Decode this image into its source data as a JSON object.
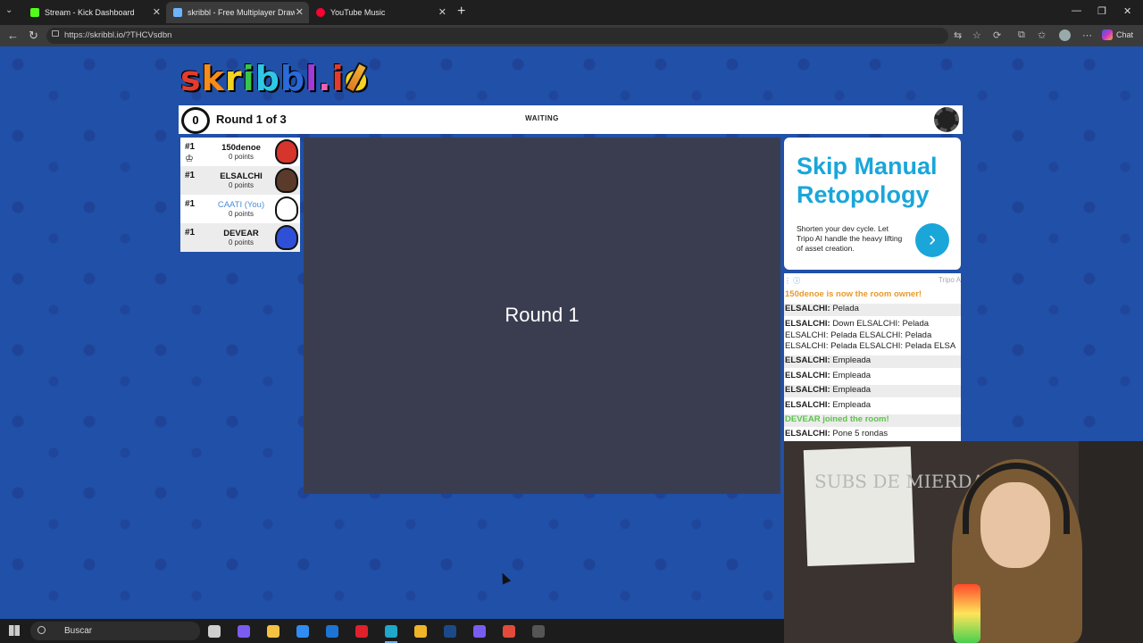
{
  "browser": {
    "tabs": [
      {
        "label": "Stream - Kick Dashboard",
        "icon": "kick-icon",
        "color": "#53fc18"
      },
      {
        "label": "skribbl - Free Multiplayer Drawing",
        "icon": "skribbl-icon",
        "color": "#6fb4ff"
      },
      {
        "label": "YouTube Music",
        "icon": "youtube-music-icon",
        "color": "#ff0033"
      }
    ],
    "url": "https://skribbl.io/?THCVsdbn",
    "chat_label": "Chat"
  },
  "game": {
    "logo_letters": [
      "s",
      "k",
      "r",
      "i",
      "b",
      "b",
      "l",
      ".",
      "i",
      "o"
    ],
    "logo_colors": [
      "#e53b2e",
      "#f58c1c",
      "#f4d21f",
      "#38c646",
      "#2fc7e6",
      "#2a6ad9",
      "#a23bd6",
      "#f05fb0",
      "#e53b2e",
      "#f4d21f"
    ],
    "timer": "0",
    "round_label": "Round 1 of 3",
    "status": "WAITING",
    "canvas_text": "Round 1",
    "players": [
      {
        "rank": "#1",
        "name": "150denoe",
        "points": "0 points",
        "avatar_color": "#d6352b",
        "owner": true,
        "you": false
      },
      {
        "rank": "#1",
        "name": "ELSALCHI",
        "points": "0 points",
        "avatar_color": "#5a3a2a",
        "owner": false,
        "you": false
      },
      {
        "rank": "#1",
        "name": "CAATI (You)",
        "points": "0 points",
        "avatar_color": "#ffffff",
        "owner": false,
        "you": true
      },
      {
        "rank": "#1",
        "name": "DEVEAR",
        "points": "0 points",
        "avatar_color": "#2f4fd6",
        "owner": false,
        "you": false
      }
    ]
  },
  "ad": {
    "title": "Skip Manual Retopology",
    "body": "Shorten your dev cycle. Let Tripo AI handle the heavy lifting of asset creation.",
    "sponsor": "Tripo A",
    "arrow": "›"
  },
  "chat": {
    "messages": [
      {
        "type": "system-orange",
        "text": "150denoe is now the room owner!"
      },
      {
        "type": "msg",
        "author": "ELSALCHI:",
        "text": "Pelada"
      },
      {
        "type": "msg",
        "author": "ELSALCHI:",
        "text": "Down ELSALCHI: Pelada ELSALCHI: Pelada ELSALCHI: Pelada ELSALCHI: Pelada ELSALCHI: Pelada ELSA"
      },
      {
        "type": "msg",
        "author": "ELSALCHI:",
        "text": "Empleada"
      },
      {
        "type": "msg",
        "author": "ELSALCHI:",
        "text": "Empleada"
      },
      {
        "type": "msg",
        "author": "ELSALCHI:",
        "text": "Empleada"
      },
      {
        "type": "msg",
        "author": "ELSALCHI:",
        "text": "Empleada"
      },
      {
        "type": "system-green",
        "text": "DEVEAR joined the room!"
      },
      {
        "type": "msg",
        "author": "ELSALCHI:",
        "text": "Pone 5 rondas"
      }
    ]
  },
  "webcam": {
    "board_text": "SUBS DE MIERDA"
  },
  "taskbar": {
    "search_placeholder": "Buscar",
    "apps": [
      {
        "name": "task-view-icon",
        "color": "#cfcfcf"
      },
      {
        "name": "copilot-icon",
        "color": "#7b5cf0"
      },
      {
        "name": "file-explorer-icon",
        "color": "#f5c242"
      },
      {
        "name": "microsoft-store-icon",
        "color": "#2f8cf0"
      },
      {
        "name": "outlook-icon",
        "color": "#1d74d4"
      },
      {
        "name": "opera-icon",
        "color": "#e0202a"
      },
      {
        "name": "edge-icon",
        "color": "#1ea8c9"
      },
      {
        "name": "chrome-icon",
        "color": "#f0b429"
      },
      {
        "name": "steam-icon",
        "color": "#1b4a8a"
      },
      {
        "name": "discord-chrome-icon",
        "color": "#7a5cf0"
      },
      {
        "name": "chrome-profile-icon",
        "color": "#e24b3b"
      },
      {
        "name": "obs-icon",
        "color": "#555555"
      }
    ]
  }
}
